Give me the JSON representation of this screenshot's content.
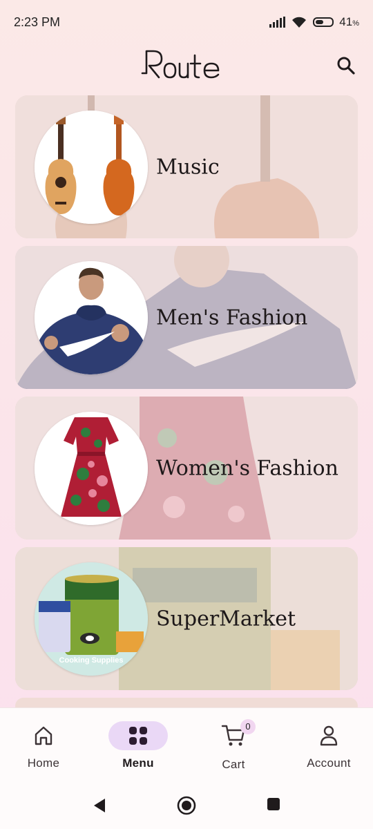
{
  "status_bar": {
    "time": "2:23 PM",
    "battery": "41",
    "battery_unit": "%"
  },
  "header": {
    "logo_text": "Route",
    "search_icon": "search-icon"
  },
  "categories": [
    {
      "name": "Music",
      "image": "guitars"
    },
    {
      "name": "Men's Fashion",
      "image": "nike-hoodie-man"
    },
    {
      "name": "Women's Fashion",
      "image": "floral-dress"
    },
    {
      "name": "SuperMarket",
      "image": "cooking-supplies",
      "image_caption": "Cooking Supplies"
    }
  ],
  "bottom_nav": {
    "items": [
      {
        "label": "Home",
        "icon": "home-icon"
      },
      {
        "label": "Menu",
        "icon": "grid-icon",
        "active": true
      },
      {
        "label": "Cart",
        "icon": "cart-icon",
        "badge": "0"
      },
      {
        "label": "Account",
        "icon": "user-icon"
      }
    ]
  },
  "colors": {
    "accent": "#3a2342",
    "pill": "#ead8f6",
    "card": "#efdcd9"
  }
}
